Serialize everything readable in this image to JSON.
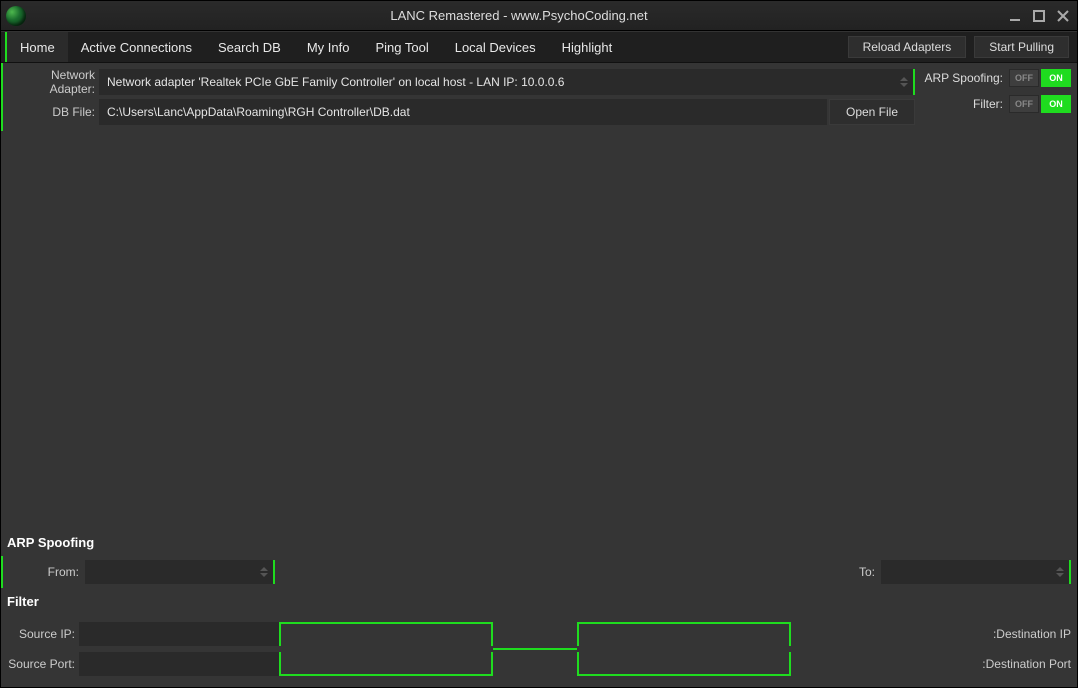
{
  "window": {
    "title": "LANC Remastered - www.PsychoCoding.net"
  },
  "tabs": [
    "Home",
    "Active Connections",
    "Search DB",
    "My Info",
    "Ping Tool",
    "Local Devices",
    "Highlight"
  ],
  "active_tab": 0,
  "toolbar": {
    "reload": "Reload Adapters",
    "start": "Start Pulling"
  },
  "form": {
    "adapter_label": "Network Adapter:",
    "adapter_value": "Network adapter 'Realtek PCIe GbE Family Controller' on local host - LAN IP: 10.0.0.6",
    "dbfile_label": "DB File:",
    "dbfile_value": "C:\\Users\\Lanc\\AppData\\Roaming\\RGH Controller\\DB.dat",
    "open_file": "Open File"
  },
  "toggles": {
    "arp_label": "ARP Spoofing:",
    "filter_label": "Filter:",
    "off": "OFF",
    "on": "ON"
  },
  "sections": {
    "arp_title": "ARP Spoofing",
    "arp_from": "From:",
    "arp_to": "To:",
    "filter_title": "Filter",
    "src_ip": "Source IP:",
    "src_port": "Source Port:",
    "dst_ip": ":Destination IP",
    "dst_port": ":Destination Port"
  }
}
